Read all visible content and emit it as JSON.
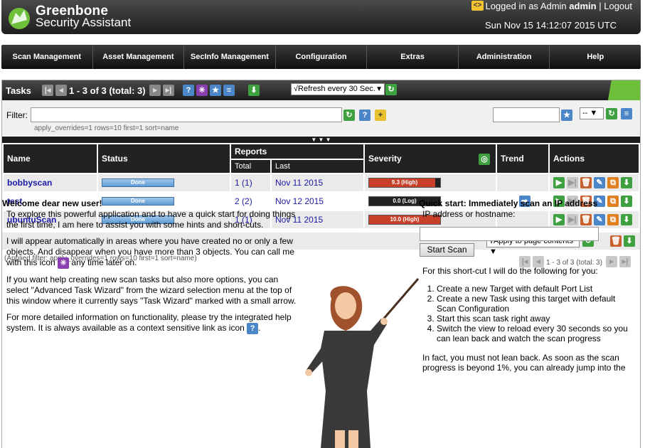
{
  "header": {
    "brand_line1": "Greenbone",
    "brand_line2": "Security Assistant",
    "lang_icon": "<>",
    "logged_in_prefix": "Logged in as Admin",
    "username": "admin",
    "separator": "|",
    "logout": "Logout",
    "datetime": "Sun Nov 15 14:12:07 2015 UTC"
  },
  "nav": [
    "Scan Management",
    "Asset Management",
    "SecInfo Management",
    "Configuration",
    "Extras",
    "Administration",
    "Help"
  ],
  "panel": {
    "title": "Tasks",
    "count": "1 - 3 of 3 (total: 3)",
    "refresh_selected": "√Refresh every 30 Sec."
  },
  "filter": {
    "label": "Filter:",
    "value": "",
    "hint": "apply_overrides=1 rows=10 first=1 sort=name",
    "select_value": "--"
  },
  "table": {
    "headers": {
      "name": "Name",
      "status": "Status",
      "reports": "Reports",
      "total": "Total",
      "last": "Last",
      "severity": "Severity",
      "trend": "Trend",
      "actions": "Actions"
    },
    "rows": [
      {
        "name": "bobbyscan",
        "status": "Done",
        "total": "1",
        "total_sub": "(1)",
        "last": "Nov 11 2015",
        "severity_label": "9.3 (High)",
        "severity_pct": 0.93,
        "trend": ""
      },
      {
        "name": "test",
        "status": "Done",
        "total": "2",
        "total_sub": "(2)",
        "last": "Nov 12 2015",
        "severity_label": "0.0 (Log)",
        "severity_pct": 0.0,
        "trend": "arrow-right"
      },
      {
        "name": "ubuntuScan",
        "status": "Done",
        "total": "1",
        "total_sub": "(1)",
        "last": "Nov 11 2015",
        "severity_label": "10.0 (High)",
        "severity_pct": 1.0,
        "trend": ""
      }
    ],
    "apply_selected": "√Apply to page contents"
  },
  "applied_filter": "(Applied filter: apply_overrides=1 rows=10 first=1 sort=name)",
  "pagination_bottom": "1 - 3 of 3 (total: 3)",
  "welcome": {
    "title": "Welcome dear new user!",
    "p1": "To explore this powerful application and to have a quick start for doing things the first time, I am here to assist you with some hints and short-cuts.",
    "p2a": "I will appear automatically in areas where you have created no or only a few objects. And disappear when you have more than 3 objects. You can call me with this icon",
    "p2b": "any time later on.",
    "p3": "If you want help creating new scan tasks but also more options, you can select \"Advanced Task Wizard\" from the wizard selection menu at the top of this window where it currently says \"Task Wizard\" marked with a small arrow.",
    "p4a": "For more detailed information on functionality, please try the integrated help system. It is always available as a context sensitive link as icon",
    "p4b": "."
  },
  "quickstart": {
    "title": "Quick start: Immediately scan an IP address",
    "ip_label": "IP address or hostname:",
    "ip_value": "",
    "start_button": "Start Scan",
    "intro": "For this short-cut I will do the following for you:",
    "steps": [
      "Create a new Target with default Port List",
      "Create a new Task using this target with default Scan Configuration",
      "Start this scan task right away",
      "Switch the view to reload every 30 seconds so you can lean back and watch the scan progress"
    ],
    "after": "In fact, you must not lean back. As soon as the scan progress is beyond 1%, you can already jump into the"
  },
  "colors": {
    "header_dark": "#1e1e1e",
    "accent_green": "#6ec03a",
    "link_blue": "#1a1aa6",
    "severity_high": "#c8402a",
    "status_blue": "#5e9bd5"
  }
}
